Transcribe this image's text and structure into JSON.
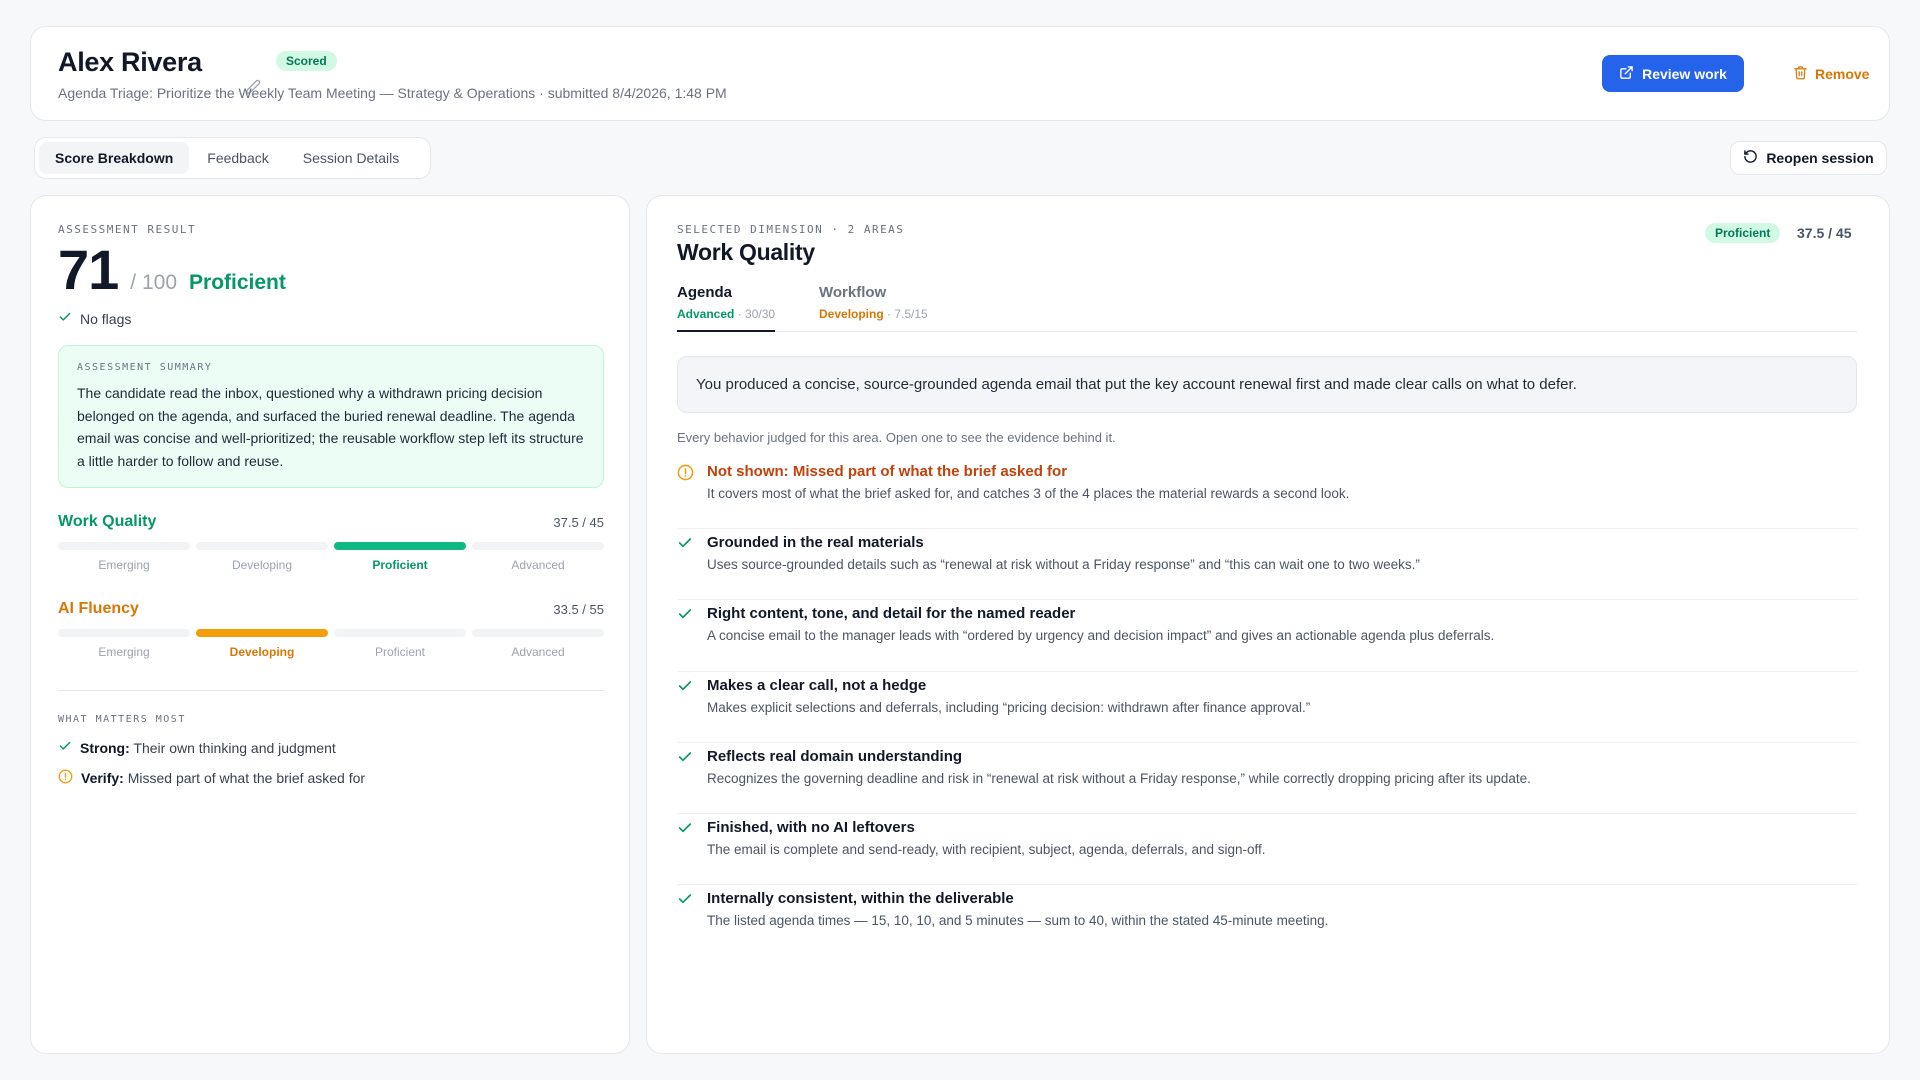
{
  "header": {
    "name": "Alex Rivera",
    "status": "Scored",
    "subtitle": "Agenda Triage: Prioritize the Weekly Team Meeting — Strategy & Operations · submitted 8/4/2026, 1:48 PM",
    "review_label": "Review work",
    "remove_label": "Remove"
  },
  "tabs": [
    "Score Breakdown",
    "Feedback",
    "Session Details"
  ],
  "reopen_label": "Reopen session",
  "result": {
    "eyebrow": "ASSESSMENT RESULT",
    "score": "71",
    "max": "/ 100",
    "level": "Proficient",
    "flags": "No flags"
  },
  "summary": {
    "eyebrow": "ASSESSMENT SUMMARY",
    "text": "The candidate read the inbox, questioned why a withdrawn pricing decision belonged on the agenda, and surfaced the buried renewal deadline. The agenda email was concise and well-prioritized; the reusable workflow step left its structure a little harder to follow and reuse."
  },
  "level_names": [
    "Emerging",
    "Developing",
    "Proficient",
    "Advanced"
  ],
  "dimensions": [
    {
      "name": "Work Quality",
      "score": "37.5 / 45",
      "level_index": 2,
      "color": "#10b981",
      "text_color": "#059669"
    },
    {
      "name": "AI Fluency",
      "score": "33.5 / 55",
      "level_index": 1,
      "color": "#f59e0b",
      "text_color": "#d97706"
    }
  ],
  "matters": {
    "title": "WHAT MATTERS MOST",
    "items": [
      {
        "kind": "check",
        "label": "Strong:",
        "text": "Their own thinking and judgment"
      },
      {
        "kind": "warn",
        "label": "Verify:",
        "text": "Missed part of what the brief asked for"
      }
    ]
  },
  "selected": {
    "eyebrow": "SELECTED DIMENSION · 2 AREAS",
    "title": "Work Quality",
    "badge": "Proficient",
    "score": "37.5 / 45",
    "areas": [
      {
        "name": "Agenda",
        "level": "Advanced",
        "points": " · 30/30",
        "level_color": "#059669",
        "active": true
      },
      {
        "name": "Workflow",
        "level": "Developing",
        "points": " · 7.5/15",
        "level_color": "#d97706",
        "active": false
      }
    ],
    "area_summary": "You produced a concise, source-grounded agenda email that put the key account renewal first and made clear calls on what to defer.",
    "hint": "Every behavior judged for this area. Open one to see the evidence behind it.",
    "behaviors": [
      {
        "kind": "warn",
        "title": "Not shown: Missed part of what the brief asked for",
        "desc": "It covers most of what the brief asked for, and catches 3 of the 4 places the material rewards a second look."
      },
      {
        "kind": "check",
        "title": "Grounded in the real materials",
        "desc": "Uses source-grounded details such as “renewal at risk without a Friday response” and “this can wait one to two weeks.”"
      },
      {
        "kind": "check",
        "title": "Right content, tone, and detail for the named reader",
        "desc": "A concise email to the manager leads with “ordered by urgency and decision impact” and gives an actionable agenda plus deferrals."
      },
      {
        "kind": "check",
        "title": "Makes a clear call, not a hedge",
        "desc": "Makes explicit selections and deferrals, including “pricing decision: withdrawn after finance approval.”"
      },
      {
        "kind": "check",
        "title": "Reflects real domain understanding",
        "desc": "Recognizes the governing deadline and risk in “renewal at risk without a Friday response,” while correctly dropping pricing after its update."
      },
      {
        "kind": "check",
        "title": "Finished, with no AI leftovers",
        "desc": "The email is complete and send-ready, with recipient, subject, agenda, deferrals, and sign-off."
      },
      {
        "kind": "check",
        "title": "Internally consistent, within the deliverable",
        "desc": "The listed agenda times — 15, 10, 10, and 5 minutes — sum to 40, within the stated 45-minute meeting."
      }
    ]
  },
  "colors": {
    "primary": "#2563eb",
    "success": "#059669",
    "warning": "#d97706"
  }
}
